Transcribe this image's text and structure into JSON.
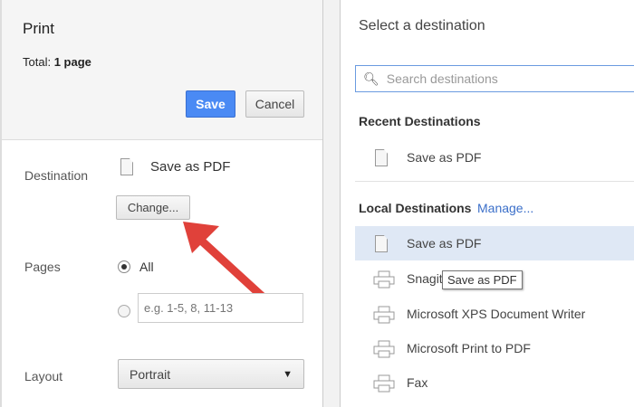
{
  "print": {
    "title": "Print",
    "total_label": "Total:",
    "total_value": "1 page",
    "save": "Save",
    "cancel": "Cancel",
    "destination_label": "Destination",
    "destination_value": "Save as PDF",
    "change": "Change...",
    "pages_label": "Pages",
    "pages_all": "All",
    "pages_placeholder": "e.g. 1-5, 8, 11-13",
    "layout_label": "Layout",
    "layout_value": "Portrait"
  },
  "dest": {
    "title": "Select a destination",
    "search_placeholder": "Search destinations",
    "recent_title": "Recent Destinations",
    "recent": [
      {
        "label": "Save as PDF",
        "icon": "document-icon"
      }
    ],
    "local_title": "Local Destinations",
    "manage": "Manage...",
    "local": [
      {
        "label": "Save as PDF",
        "icon": "document-icon",
        "selected": true
      },
      {
        "label": "Snagit",
        "icon": "printer-icon"
      },
      {
        "label": "Microsoft XPS Document Writer",
        "icon": "printer-icon"
      },
      {
        "label": "Microsoft Print to PDF",
        "icon": "printer-icon"
      },
      {
        "label": "Fax",
        "icon": "printer-icon"
      }
    ],
    "tooltip": "Save as PDF"
  },
  "colors": {
    "accent": "#4a8af4",
    "arrow": "#e0413a",
    "selected": "#dfe8f5",
    "link": "#3b6fc9"
  }
}
